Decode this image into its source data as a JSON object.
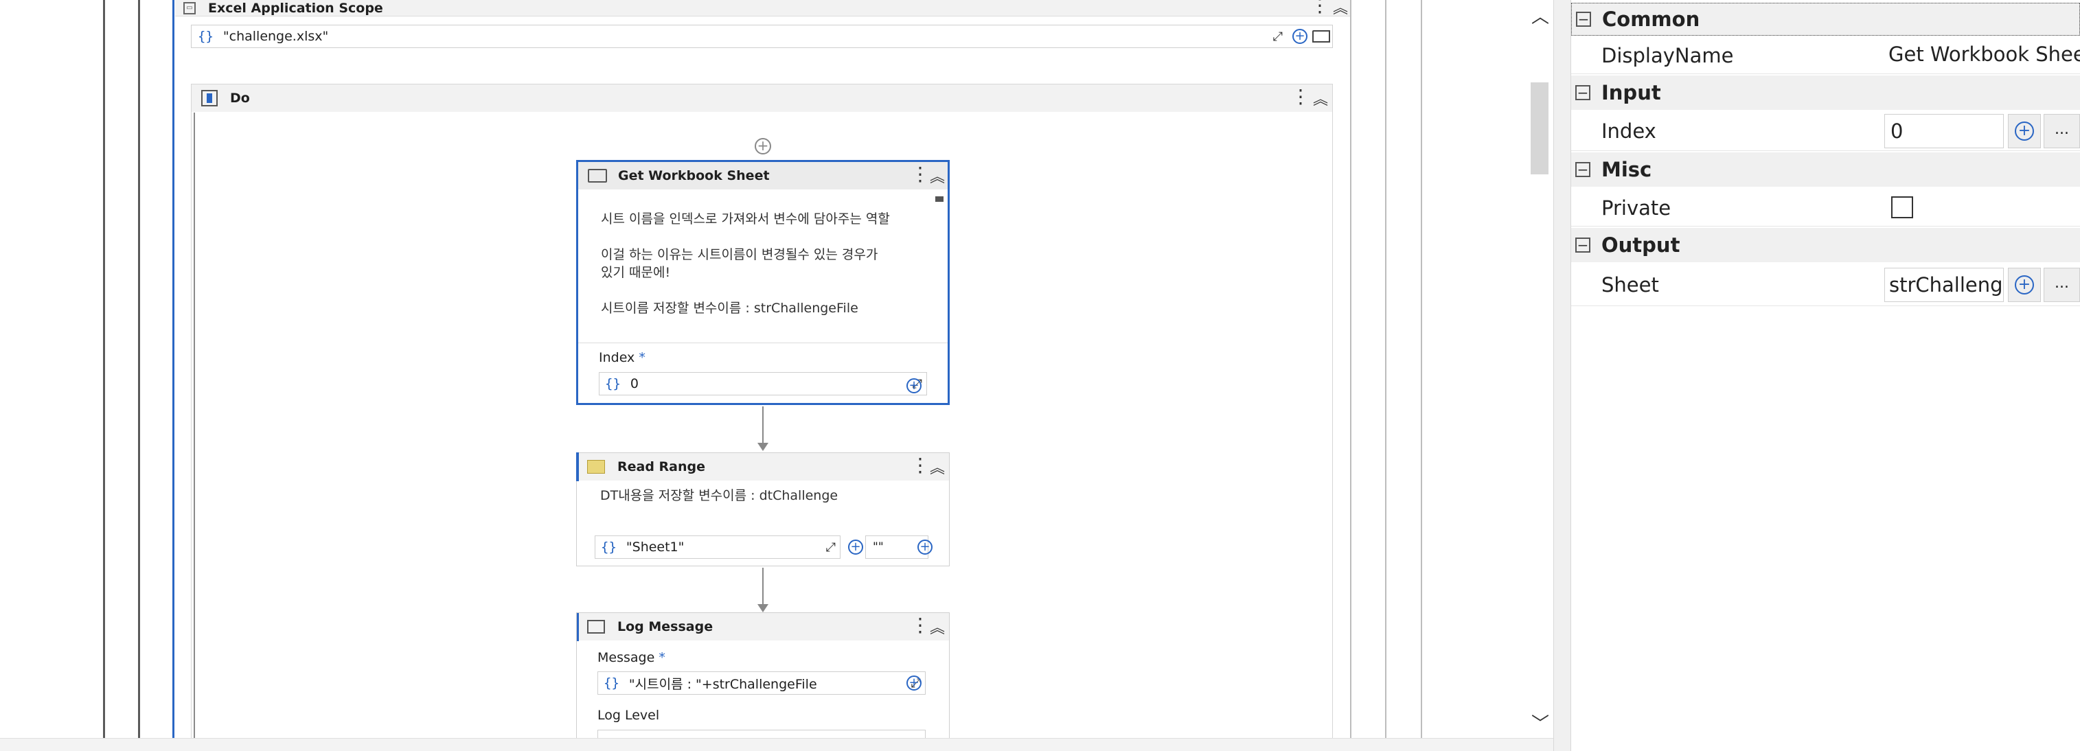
{
  "designer": {
    "excel_scope": {
      "title": "Excel Application Scope",
      "path_value": "\"challenge.xlsx\""
    },
    "do_block": {
      "title": "Do"
    },
    "get_workbook_sheet": {
      "title": "Get Workbook Sheet",
      "annotation_line1": "시트 이름을 인덱스로 가져와서 변수에 담아주는 역할",
      "annotation_line2": "이걸 하는 이유는 시트이름이 변경될수 있는 경우가",
      "annotation_line3": "있기 때문에!",
      "annotation_line4": "시트이름 저장할 변수이름 : strChallengeFile",
      "index_label": "Index",
      "required_mark": "*",
      "index_value": "0"
    },
    "read_range": {
      "title": "Read Range",
      "annotation": "DT내용을 저장할 변수이름 : dtChallenge",
      "sheet_value": "\"Sheet1\"",
      "range_value": "\"\""
    },
    "log_message": {
      "title": "Log Message",
      "message_label": "Message",
      "required_mark": "*",
      "message_value": "\"시트이름 : \"+strChallengeFile",
      "log_level_label": "Log Level"
    }
  },
  "properties": {
    "sections": {
      "common": "Common",
      "input": "Input",
      "misc": "Misc",
      "output": "Output"
    },
    "display_name_label": "DisplayName",
    "display_name_value": "Get Workbook Shee",
    "index_label": "Index",
    "index_value": "0",
    "private_label": "Private",
    "sheet_label": "Sheet",
    "sheet_value": "strChalleng",
    "ellipsis": "..."
  },
  "icons": {
    "braces": "{}",
    "plus": "+",
    "expand": "⤢",
    "kebab": "⋮",
    "collapse": "︽",
    "folder": "folder-icon",
    "scroll_up": "︿",
    "scroll_down": "﹀",
    "minus": "−"
  }
}
